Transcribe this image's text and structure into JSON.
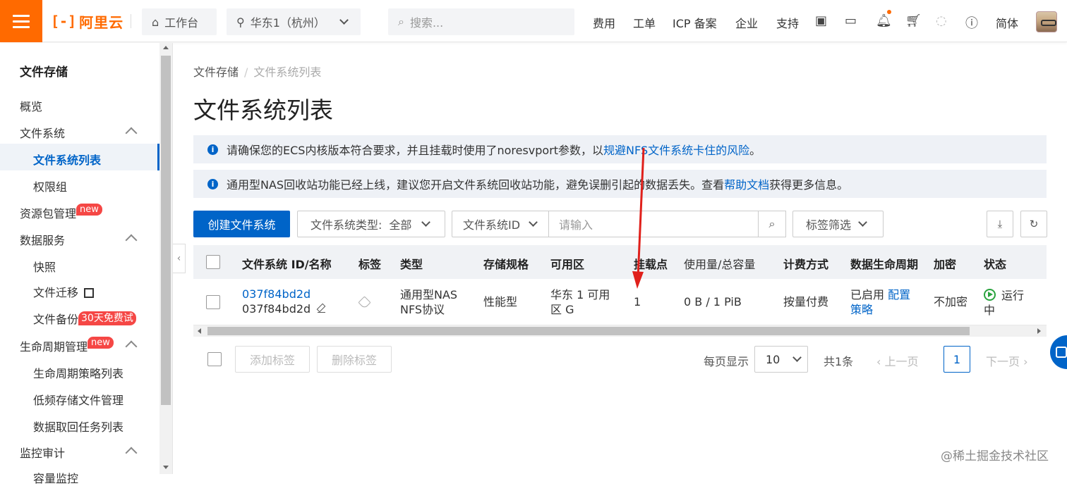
{
  "topbar": {
    "logo_mark": "[-]",
    "logo_text": "阿里云",
    "workbench": "工作台",
    "region": "华东1（杭州）",
    "search_placeholder": "搜索...",
    "menu": [
      "费用",
      "工单",
      "ICP 备案",
      "企业",
      "支持"
    ],
    "lang": "简体"
  },
  "sidebar": {
    "title": "文件存储",
    "items": {
      "overview": "概览",
      "fs": "文件系统",
      "fs_list": "文件系统列表",
      "perm_group": "权限组",
      "pkg_mgmt": "资源包管理",
      "data_service": "数据服务",
      "snapshot": "快照",
      "migration": "文件迁移",
      "backup": "文件备份",
      "lifecycle": "生命周期管理",
      "lc_policy": "生命周期策略列表",
      "lowfreq": "低频存储文件管理",
      "retrieve": "数据取回任务列表",
      "monitor": "监控审计",
      "monitor_sub": "容量监控"
    },
    "badge_new": "new",
    "badge_promo": "30天免费试"
  },
  "breadcrumb": {
    "root": "文件存储",
    "sep": "/",
    "current": "文件系统列表"
  },
  "page_title": "文件系统列表",
  "notice1": {
    "text": "请确保您的ECS内核版本符合要求，并且挂载时使用了noresvport参数，以",
    "link": "规避NFS文件系统卡住的风险",
    "tail": "。"
  },
  "notice2": {
    "text": "通用型NAS回收站功能已经上线，建议您开启文件系统回收站功能，避免误删引起的数据丢失。查看",
    "link": "帮助文档",
    "tail": "获得更多信息。"
  },
  "toolbar": {
    "create": "创建文件系统",
    "type_label": "文件系统类型:",
    "type_value": "全部",
    "id_label": "文件系统ID",
    "input_placeholder": "请输入",
    "tag_filter": "标签筛选"
  },
  "table": {
    "headers": [
      "文件系统 ID/名称",
      "标签",
      "类型",
      "存储规格",
      "可用区",
      "挂载点",
      "使用量/总容量",
      "计费方式",
      "数据生命周期",
      "加密",
      "状态"
    ],
    "row": {
      "id": "037f84bd2d",
      "name": "037f84bd2d",
      "type_l1": "通用型NAS",
      "type_l2": "NFS协议",
      "spec": "性能型",
      "zone_l1": "华东 1 可用",
      "zone_l2": "区 G",
      "mounts": "1",
      "usage": "0 B / 1 PiB",
      "billing": "按量付费",
      "lifecycle": "已启用",
      "lifecycle_link1": "配置",
      "lifecycle_link2": "策略",
      "encrypt": "不加密",
      "status_l1": "运行",
      "status_l2": "中"
    }
  },
  "footer": {
    "add_tag": "添加标签",
    "del_tag": "删除标签",
    "per_page": "每页显示",
    "page_size": "10",
    "total": "共1条",
    "prev": "上一页",
    "page": "1",
    "next": "下一页"
  },
  "watermark": "@稀土掘金技术社区",
  "colors": {
    "brand": "#ff6a00",
    "primary": "#0064c8",
    "running": "#2aa33e",
    "annotation": "#e0201b"
  }
}
